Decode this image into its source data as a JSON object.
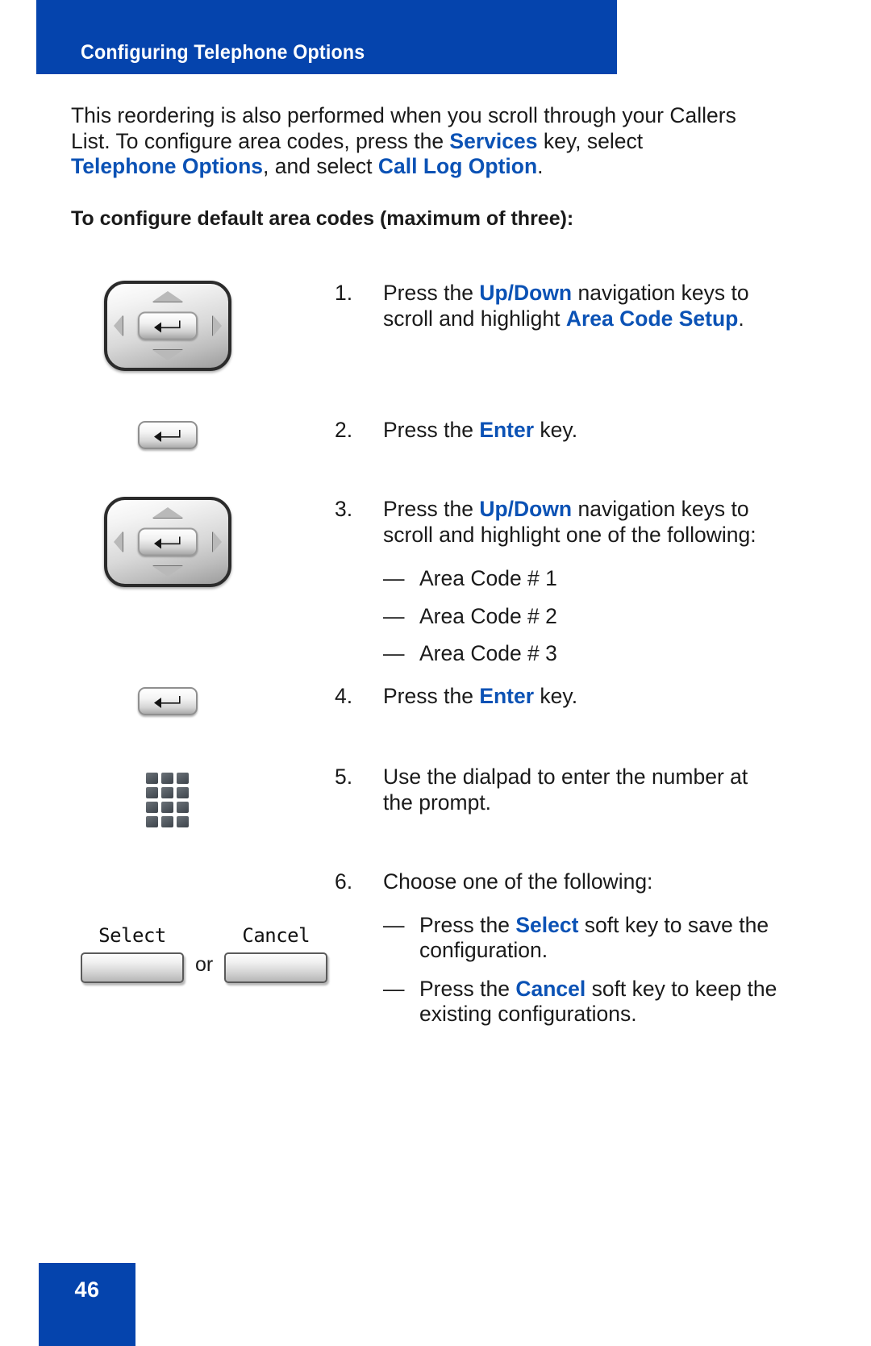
{
  "header": {
    "title": "Configuring Telephone Options",
    "bar_color": "#0544ad"
  },
  "intro": {
    "part1": "This reordering is also performed when you scroll through your Callers List. To configure area codes, press the ",
    "services": "Services",
    "part2": " key, select ",
    "telephone_options": "Telephone Options",
    "part3": ", and select ",
    "call_log_option": "Call Log Option",
    "part4": "."
  },
  "subheading": "To configure default area codes (maximum of three):",
  "accent_color": "#0b52b5",
  "steps": [
    {
      "number": "1.",
      "icon": "navigation-key-icon",
      "text_part1": "Press the ",
      "bold1": "Up/Down",
      "text_part2": " navigation keys to scroll and highlight ",
      "bold2": "Area Code Setup",
      "text_part3": "."
    },
    {
      "number": "2.",
      "icon": "enter-key-icon",
      "text_part1": "Press the ",
      "bold1": "Enter",
      "text_part2": " key.",
      "bold2": "",
      "text_part3": ""
    },
    {
      "number": "3.",
      "icon": "navigation-key-icon",
      "text_part1": "Press the ",
      "bold1": "Up/Down",
      "text_part2": " navigation keys to scroll and highlight one of the following:",
      "bold2": "",
      "text_part3": "",
      "sub_items": [
        {
          "dash": "—",
          "label": "Area Code # 1"
        },
        {
          "dash": "—",
          "label": "Area Code # 2"
        },
        {
          "dash": "—",
          "label": "Area Code # 3"
        }
      ]
    },
    {
      "number": "4.",
      "icon": "enter-key-icon",
      "text_part1": "Press the ",
      "bold1": "Enter",
      "text_part2": " key.",
      "bold2": "",
      "text_part3": ""
    },
    {
      "number": "5.",
      "icon": "dialpad-icon",
      "text_part1": "Use the dialpad to enter the number at the prompt.",
      "bold1": "",
      "text_part2": "",
      "bold2": "",
      "text_part3": ""
    },
    {
      "number": "6.",
      "icon": "softkeys-icon",
      "text_part1": "Choose one of the following:",
      "bold1": "",
      "text_part2": "",
      "bold2": "",
      "text_part3": "",
      "sub_items": [
        {
          "dash": "—",
          "pre": "Press the ",
          "bold": "Select",
          "post": " soft key to save the configuration."
        },
        {
          "dash": "—",
          "pre": "Press the ",
          "bold": "Cancel",
          "post": " soft key to keep the existing configurations."
        }
      ]
    }
  ],
  "softkeys": {
    "select_label": "Select",
    "or_label": "or",
    "cancel_label": "Cancel"
  },
  "footer": {
    "page_number": "46",
    "block_color": "#0544ad"
  }
}
